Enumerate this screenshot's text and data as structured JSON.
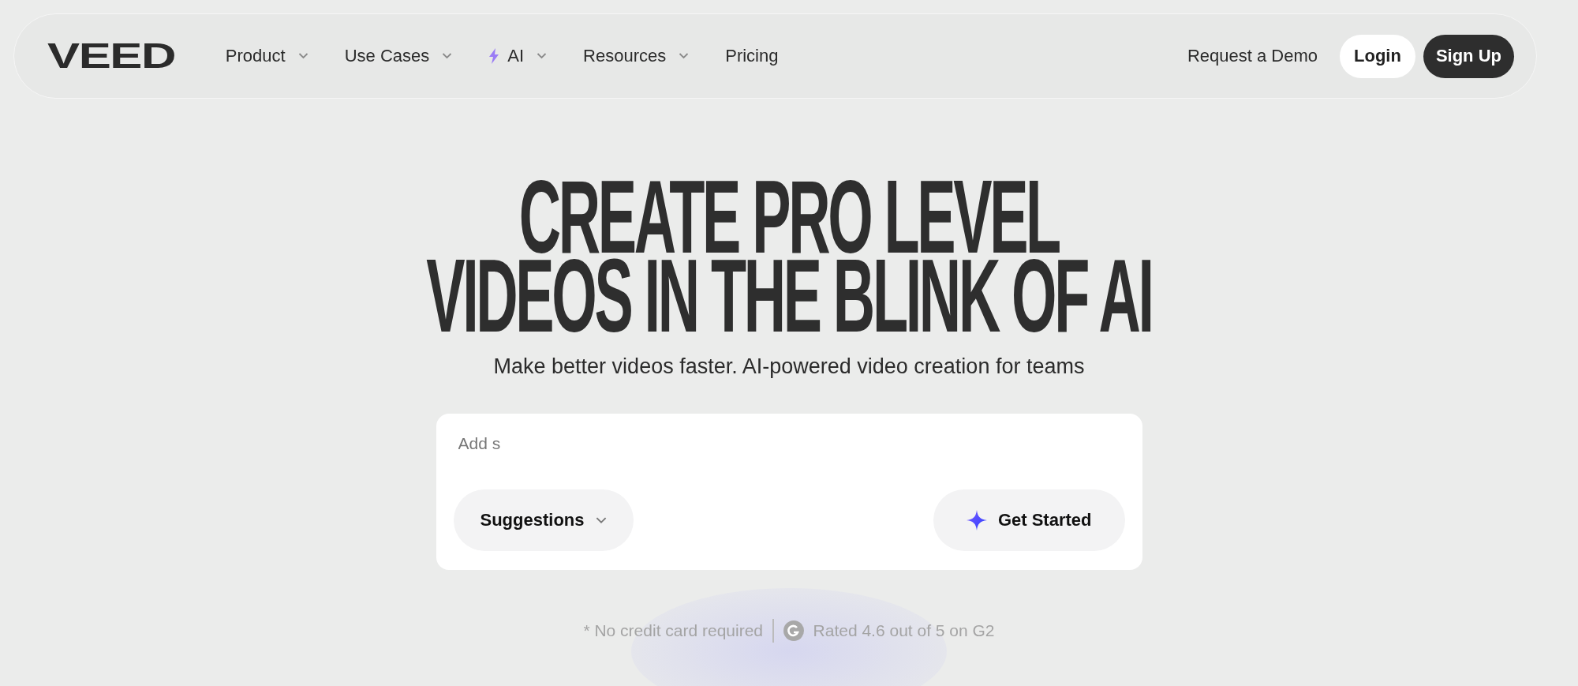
{
  "nav": {
    "logo": "VEED",
    "items": [
      {
        "label": "Product",
        "dropdown": true,
        "kind": "plain"
      },
      {
        "label": "Use Cases",
        "dropdown": true,
        "kind": "plain"
      },
      {
        "label": "AI",
        "dropdown": true,
        "kind": "ai"
      },
      {
        "label": "Resources",
        "dropdown": true,
        "kind": "plain"
      },
      {
        "label": "Pricing",
        "dropdown": false,
        "kind": "plain"
      }
    ],
    "demo_link": "Request a Demo",
    "login": "Login",
    "signup": "Sign Up"
  },
  "hero": {
    "title_lines": [
      "CREATE PRO LEVEL",
      "VIDEOS IN THE BLINK OF AI"
    ],
    "subtitle": "Make better videos faster. AI-powered video creation for teams"
  },
  "prompt": {
    "placeholder": "Add s",
    "suggestions": "Suggestions",
    "cta": "Get Started"
  },
  "footer_note": {
    "no_card": "* No credit card required",
    "rating": "Rated 4.6 out of 5 on G2"
  }
}
